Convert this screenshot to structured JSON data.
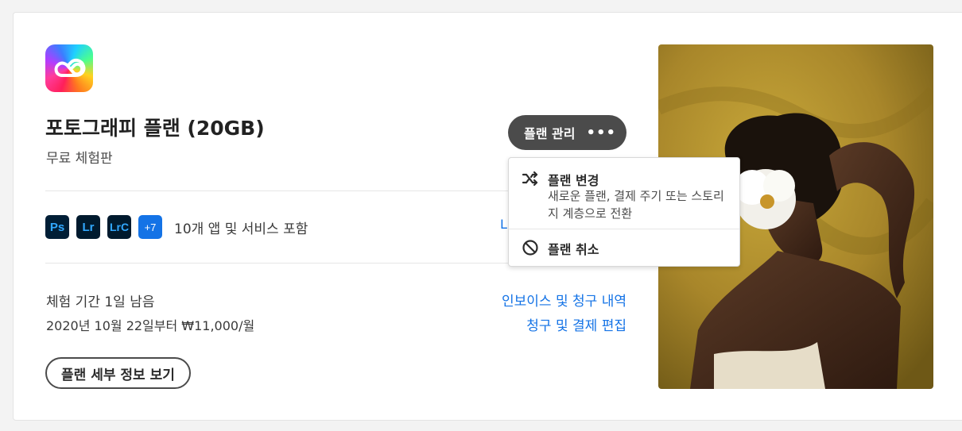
{
  "plan": {
    "title": "포토그래피 플랜 (20GB)",
    "subtitle": "무료 체험판",
    "apps": [
      {
        "label": "Ps",
        "icon": "photoshop-icon"
      },
      {
        "label": "Lr",
        "icon": "lightroom-icon"
      },
      {
        "label": "LrC",
        "icon": "lightroom-classic-icon"
      },
      {
        "label": "+7",
        "icon": "more-apps-badge"
      }
    ],
    "apps_text": "10개 앱 및 서비스 포함",
    "hidden_link_text": "L",
    "trial_remaining": "체험 기간 1일 남음",
    "price_text": "2020년 10월 22일부터 ₩11,000/월",
    "details_button": "플랜 세부 정보 보기"
  },
  "links": {
    "invoice": "인보이스 및 청구 내역",
    "billing": "청구 및 결제 편집"
  },
  "manage": {
    "label": "플랜 관리",
    "more_icon": "•••"
  },
  "menu": {
    "change_label": "플랜 변경",
    "change_desc": "새로운 플랜, 결제 주기 또는 스토리지 계층으로 전환",
    "cancel_label": "플랜 취소"
  },
  "colors": {
    "accent": "#1473e6",
    "button_dark": "#4b4b4b",
    "photoshop_bg": "#001e36",
    "photoshop_fg": "#31a8ff"
  }
}
